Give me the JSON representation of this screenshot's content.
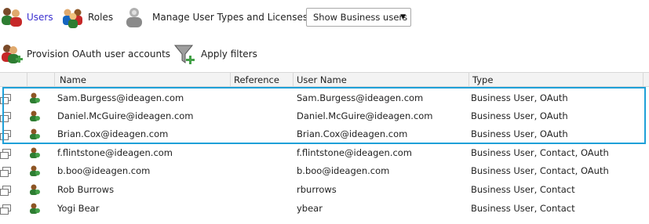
{
  "toolbar": {
    "users_label": "Users",
    "roles_label": "Roles",
    "manage_label": "Manage User Types and Licenses",
    "filter_select_value": "Show Business users",
    "provision_label": "Provision OAuth user accounts",
    "apply_filters_label": "Apply filters"
  },
  "table": {
    "columns": [
      "Name",
      "Reference",
      "User Name",
      "Type"
    ],
    "rows": [
      {
        "name": "Sam.Burgess@ideagen.com",
        "reference": "",
        "username": "Sam.Burgess@ideagen.com",
        "type": "Business User, OAuth"
      },
      {
        "name": "Daniel.McGuire@ideagen.com",
        "reference": "",
        "username": "Daniel.McGuire@ideagen.com",
        "type": "Business User, OAuth"
      },
      {
        "name": "Brian.Cox@ideagen.com",
        "reference": "",
        "username": "Brian.Cox@ideagen.com",
        "type": "Business User, OAuth"
      },
      {
        "name": "f.flintstone@ideagen.com",
        "reference": "",
        "username": "f.flintstone@ideagen.com",
        "type": "Business User, Contact, OAuth"
      },
      {
        "name": "b.boo@ideagen.com",
        "reference": "",
        "username": "b.boo@ideagen.com",
        "type": "Business User, Contact, OAuth"
      },
      {
        "name": "Rob Burrows",
        "reference": "",
        "username": "rburrows",
        "type": "Business User, Contact"
      },
      {
        "name": "Yogi Bear",
        "reference": "",
        "username": "ybear",
        "type": "Business User, Contact"
      }
    ]
  },
  "colors": {
    "accent": "#3a2fcf",
    "highlight": "#1fa0d8"
  }
}
